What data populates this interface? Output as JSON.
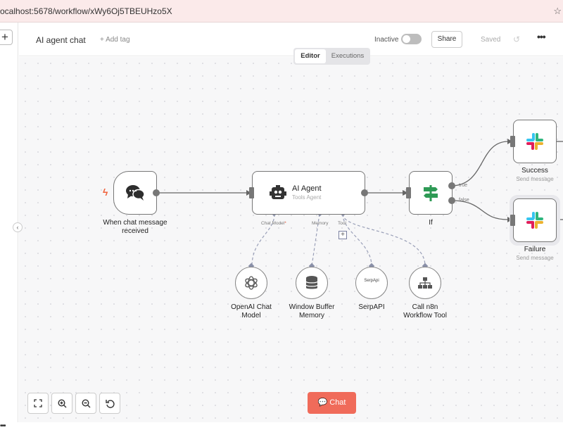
{
  "browser": {
    "url": "ocalhost:5678/workflow/xWy6Oj5TBEUHzo5X"
  },
  "header": {
    "title": "AI agent chat",
    "add_tag": "+ Add tag",
    "status_label": "Inactive",
    "share_label": "Share",
    "saved_label": "Saved"
  },
  "tabs": {
    "editor": "Editor",
    "executions": "Executions"
  },
  "nodes": {
    "trigger": {
      "label_line1": "When chat message",
      "label_line2": "received",
      "icon": "chat-bubbles-icon"
    },
    "agent": {
      "title": "AI Agent",
      "subtitle": "Tools Agent",
      "icon": "robot-icon"
    },
    "if": {
      "label": "If",
      "icon": "signpost-icon",
      "true_label": "true",
      "false_label": "false"
    },
    "success": {
      "label": "Success",
      "subtitle": "Send message",
      "icon": "slack-icon"
    },
    "failure": {
      "label": "Failure",
      "subtitle": "Send message",
      "icon": "slack-icon"
    }
  },
  "agent_handles": {
    "chat_model": "Chat Model",
    "chat_model_required": "*",
    "memory": "Memory",
    "tool": "Tool"
  },
  "sub_nodes": [
    {
      "line1": "OpenAI Chat",
      "line2": "Model",
      "icon": "openai-icon"
    },
    {
      "line1": "Window Buffer",
      "line2": "Memory",
      "icon": "database-icon"
    },
    {
      "line1": "SerpAPI",
      "line2": "",
      "icon_text": "SerpApi"
    },
    {
      "line1": "Call n8n",
      "line2": "Workflow Tool",
      "icon": "sitemap-icon"
    }
  ],
  "canvas_controls": {
    "chat_label": "Chat"
  },
  "colors": {
    "accent": "#f06b5a",
    "trigger_bolt": "#f0623b",
    "if_icon": "#2e9a55"
  }
}
